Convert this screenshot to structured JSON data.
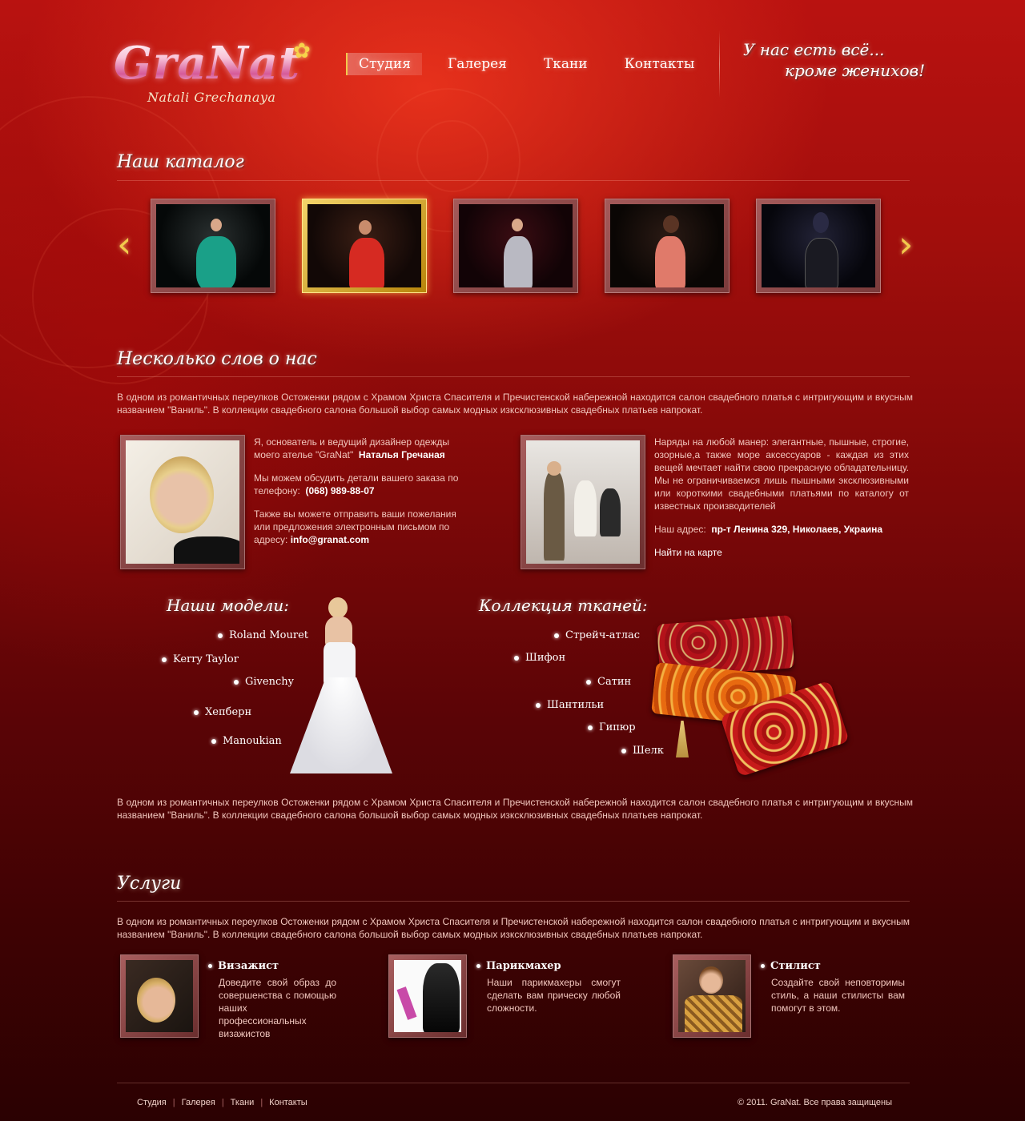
{
  "header": {
    "logo": {
      "name": "GraNat",
      "subtitle": "Natali Grechanaya"
    },
    "nav": [
      {
        "label": "Студия",
        "active": true
      },
      {
        "label": "Галерея",
        "active": false
      },
      {
        "label": "Ткани",
        "active": false
      },
      {
        "label": "Контакты",
        "active": false
      }
    ],
    "slogan": {
      "line1": "У нас есть всё...",
      "line2": "кроме женихов!"
    }
  },
  "catalog": {
    "title": "Наш каталог",
    "prev_icon": "chevron-left-icon",
    "next_icon": "chevron-right-icon",
    "items": [
      {
        "dress_color": "#1aa088",
        "active": false
      },
      {
        "dress_color": "#d62a22",
        "active": true
      },
      {
        "dress_color": "#b9b9c2",
        "active": false
      },
      {
        "dress_color": "#e07a6a",
        "active": false
      },
      {
        "dress_color": "#1a1a22",
        "active": false
      }
    ]
  },
  "about": {
    "title": "Несколько слов о нас",
    "intro": "В одном из романтичных переулков Остоженки рядом с Храмом Христа Спасителя и Пречистенской набережной находится салон свадебного платья с интригующим и вкусным названием \"Ваниль\". В коллекции свадебного салона большой выбор самых модных изксклюзивных свадебных платьев напрокат.",
    "founder": {
      "text1": "Я, основатель и ведущий дизайнер одежды моего ателье \"GraNat\"",
      "name": "Наталья Гречаная",
      "text2": "Мы можем обсудить детали вашего заказа по телефону:",
      "phone": "(068) 989-88-07",
      "text3": "Также вы можете отправить ваши пожелания или предложения электронным письмом по адресу:",
      "email": "info@granat.com"
    },
    "studio": {
      "text": "Наряды на любой манер: элегантные, пышные, строгие, озорные,а также море аксессуаров - каждая из этих вещей мечтает найти свою прекрасную обладательницу. Мы не ограничиваемся лишь пышными эксклюзивными или короткими свадебными платьями по каталогу от известных производителей",
      "address_label": "Наш адрес:",
      "address": "пр-т Ленина 329, Николаев, Украина",
      "map_link": "Найти на карте"
    }
  },
  "models": {
    "title": "Наши модели:",
    "items": [
      "Roland Mouret",
      "Kerry Taylor",
      "Givenchy",
      "Хепберн",
      "Manoukian"
    ]
  },
  "fabrics": {
    "title": "Коллекция тканей:",
    "items": [
      "Стрейч-атлас",
      "Шифон",
      "Сатин",
      "Шантильи",
      "Гипюр",
      "Шелк"
    ]
  },
  "about_text2": "В одном из романтичных переулков Остоженки рядом с Храмом Христа Спасителя и Пречистенской набережной находится салон свадебного платья с интригующим и вкусным названием \"Ваниль\". В коллекции свадебного салона большой выбор самых модных изксклюзивных свадебных платьев напрокат.",
  "services": {
    "title": "Услуги",
    "intro": "В одном из романтичных переулков Остоженки рядом с Храмом Христа Спасителя и Пречистенской набережной находится салон свадебного платья с интригующим и вкусным названием \"Ваниль\". В коллекции свадебного салона большой выбор самых модных изксклюзивных свадебных платьев напрокат.",
    "items": [
      {
        "title": "Визажист",
        "desc": "Доведите свой образ до совершенства с помощью наших профессиональных визажистов"
      },
      {
        "title": "Парикмахер",
        "desc": "Наши парикмахеры смогут сделать вам прическу любой сложности."
      },
      {
        "title": "Стилист",
        "desc": "Создайте свой неповторимы стиль, а наши стилисты вам помогут в этом."
      }
    ]
  },
  "footer": {
    "nav": [
      "Студия",
      "Галерея",
      "Ткани",
      "Контакты"
    ],
    "separator": "|",
    "copyright": "© 2011. GraNat.  Все права защищены"
  },
  "colors": {
    "accent": "#f2c94c",
    "background": "#a10e0c",
    "text": "#f2c7be"
  }
}
